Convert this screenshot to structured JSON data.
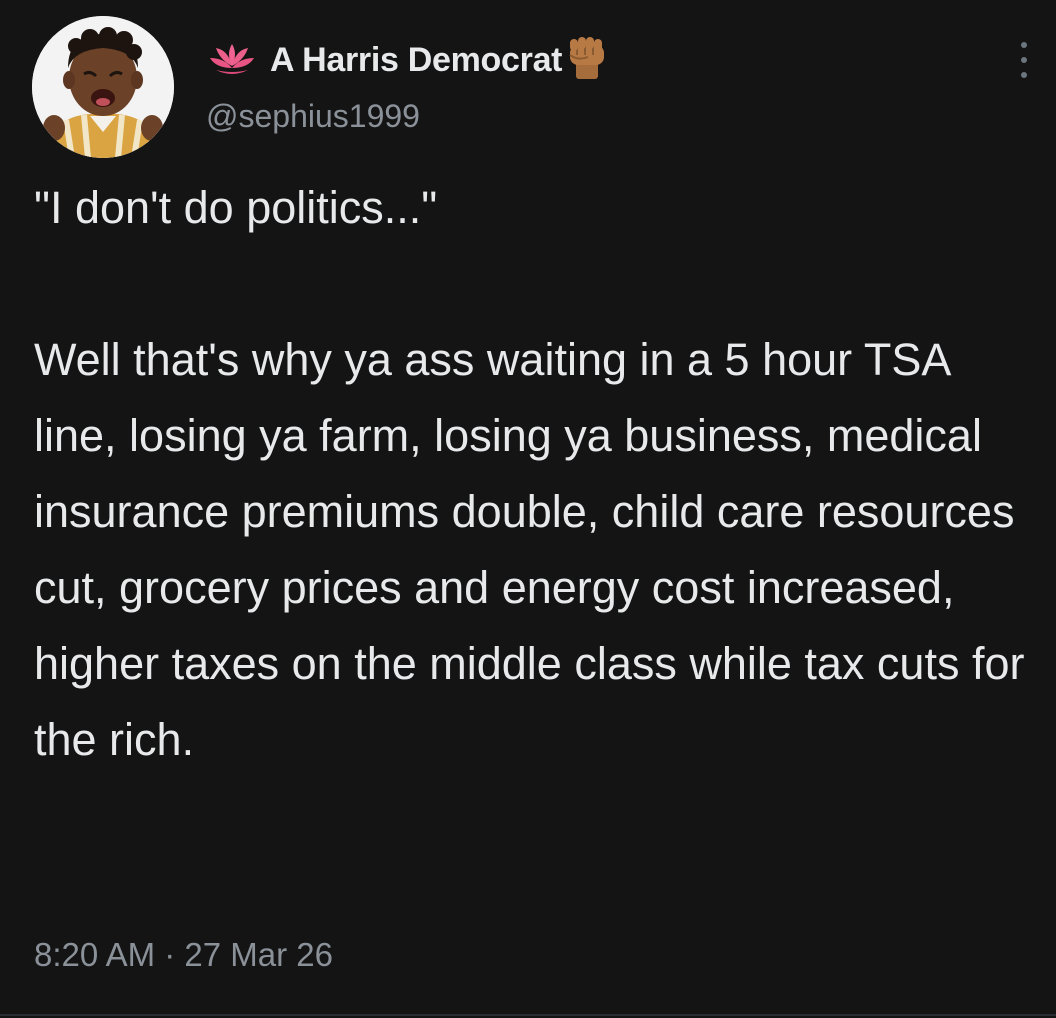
{
  "tweet": {
    "author": {
      "display_name": "A Harris Democrat",
      "handle": "@sephius1999",
      "name_prefix_icon": "lotus-icon",
      "name_suffix_icon": "raised-fist-icon",
      "avatar": "crying-baby-avatar"
    },
    "text": "\"I don't do politics...\"\n\nWell that's why ya ass waiting in a 5 hour TSA line, losing ya farm, losing ya business, medical insurance premiums double, child care resources cut, grocery prices and energy cost increased, higher taxes on the middle class while tax cuts for the rich.",
    "timestamp": "8:20 AM · 27 Mar 26",
    "more_icon": "more-options-icon"
  },
  "colors": {
    "background": "#141414",
    "primary_text": "#e7e9ea",
    "secondary_text": "#8b9199"
  }
}
